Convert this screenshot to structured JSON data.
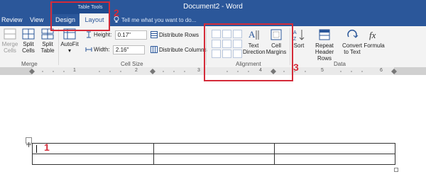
{
  "window": {
    "title": "Document2 - Word",
    "context_label": "Table Tools"
  },
  "tabs": [
    {
      "label": "Review"
    },
    {
      "label": "View"
    },
    {
      "label": "Design"
    },
    {
      "label": "Layout",
      "active": true
    }
  ],
  "tell_me": {
    "placeholder": "Tell me what you want to do..."
  },
  "ribbon": {
    "merge": {
      "merge_cells": "Merge\nCells",
      "split_cells": "Split\nCells",
      "split_table": "Split\nTable",
      "group": "Merge"
    },
    "cell_size": {
      "autofit": "AutoFit",
      "height_label": "Height:",
      "height_value": "0.17\"",
      "width_label": "Width:",
      "width_value": "2.16\"",
      "distribute_rows": "Distribute Rows",
      "distribute_columns": "Distribute Columns",
      "group": "Cell Size"
    },
    "alignment": {
      "text_direction": "Text\nDirection",
      "cell_margins": "Cell\nMargins",
      "group": "Alignment"
    },
    "data": {
      "sort": "Sort",
      "repeat_header": "Repeat\nHeader Rows",
      "convert": "Convert\nto Text",
      "formula": "Formula",
      "group": "Data"
    }
  },
  "ruler": {
    "numbers": [
      "1",
      "2",
      "3",
      "4",
      "5",
      "6"
    ]
  },
  "annotations": [
    "1",
    "2",
    "3"
  ],
  "colors": {
    "accent": "#2b579a",
    "highlight": "#d42b39"
  }
}
